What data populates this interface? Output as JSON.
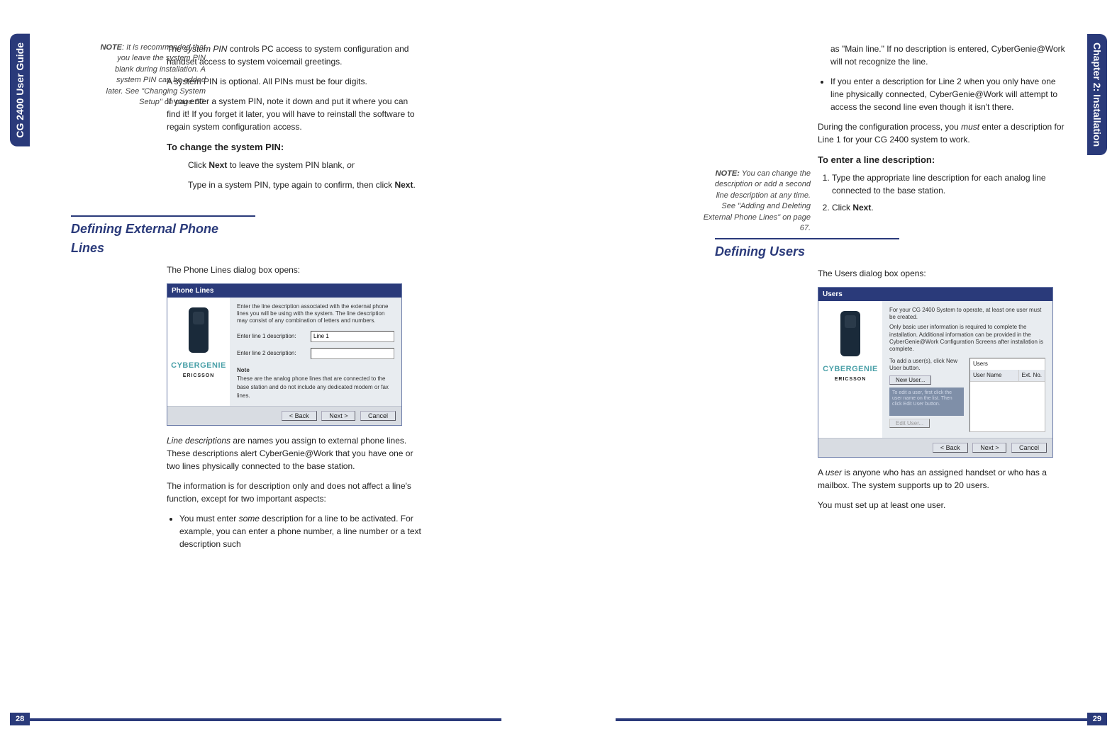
{
  "left_tab": "CG 2400 User Guide",
  "right_tab": "Chapter 2: Installation",
  "left_page_num": "28",
  "right_page_num": "29",
  "note1_label": "NOTE",
  "note1_text": ": It is recommended that you leave the system PIN blank during installation. A system PIN can be added later. See \"Changing System Setup\" on page 60.",
  "p1a": "The ",
  "p1b": "system PIN",
  "p1c": " controls PC access to system configuration and handset access to system voicemail greetings.",
  "p2": "A system PIN is optional. All PINs must be four digits.",
  "p3": "If you enter a system PIN, note it down and put it where you can find it! If you forget it later, you will have to reinstall the software to regain system configuration access.",
  "sub1": "To change the system PIN:",
  "step1a": "Click ",
  "step1b": "Next",
  "step1c": " to leave the system PIN blank, ",
  "step1d": "or",
  "step2a": "Type in a system PIN, type again to confirm, then click ",
  "step2b": "Next",
  "step2c": ".",
  "sec1": "Defining External Phone Lines",
  "sec1_intro": "The Phone Lines dialog box opens:",
  "dlg1_title": "Phone Lines",
  "dlg1_desc": "Enter the line description associated with the external phone lines you will be using with the system. The line description may consist of any combination of letters and numbers.",
  "dlg1_l1label": "Enter line 1 description:",
  "dlg1_l1val": "Line 1",
  "dlg1_l2label": "Enter line 2 description:",
  "dlg1_note_h": "Note",
  "dlg1_note": "These are the analog phone lines that are connected to the base station and do not include any dedicated modem or fax lines.",
  "dlg_back": "< Back",
  "dlg_next": "Next >",
  "dlg_cancel": "Cancel",
  "brand": "CYBERGENIE",
  "brand2": "ERICSSON",
  "p4a": "Line descriptions",
  "p4b": " are names you assign to external phone lines. These descriptions alert CyberGenie@Work that you have one or two lines physically connected to the base station.",
  "p5": "The information is for description only and does not affect a line's function, except for two important aspects:",
  "b1a": "You must enter ",
  "b1b": "some",
  "b1c": " description for a line to be activated. For example, you can enter a phone number, a line number or a text description such",
  "r_p1": "as \"Main line.\" If no description is entered, CyberGenie@Work will not recognize the line.",
  "r_b1": "If you enter a description for Line 2 when you only have one line physically connected, CyberGenie@Work will attempt to access the second line even though it isn't there.",
  "r_p2a": "During the configuration process, you ",
  "r_p2b": "must",
  "r_p2c": " enter a description for Line 1 for your CG 2400 system to work.",
  "note2_label": "NOTE:",
  "note2_text": " You can change the description or add a second line description at any time. See \"Adding and Deleting External Phone Lines\" on page 67.",
  "sub2": "To enter a line description:",
  "r_s1": "Type the appropriate line description for each analog line connected to the base station.",
  "r_s2a": "Click ",
  "r_s2b": "Next",
  "r_s2c": ".",
  "sec2": "Defining Users",
  "sec2_intro": "The Users dialog box opens:",
  "dlg2_title": "Users",
  "dlg2_desc1": "For your CG 2400 System to operate, at least one user must be created.",
  "dlg2_desc2": "Only basic user information is required to complete the installation. Additional information can be provided in the CyberGenie@Work Configuration Screens after installation is complete.",
  "dlg2_add": "To add a user(s), click New User button.",
  "dlg2_newuser": "New User...",
  "dlg2_grey": "To edit a user, first click the user name on the list. Then click Edit User button.",
  "dlg2_edituser": "Edit User...",
  "dlg2_users_h": "Users",
  "dlg2_col1": "User Name",
  "dlg2_col2": "Ext. No.",
  "r_p3a": "A ",
  "r_p3b": "user",
  "r_p3c": " is anyone who has an assigned handset or who has a mailbox. The system supports up to 20 users.",
  "r_p4": "You must set up at least one user."
}
